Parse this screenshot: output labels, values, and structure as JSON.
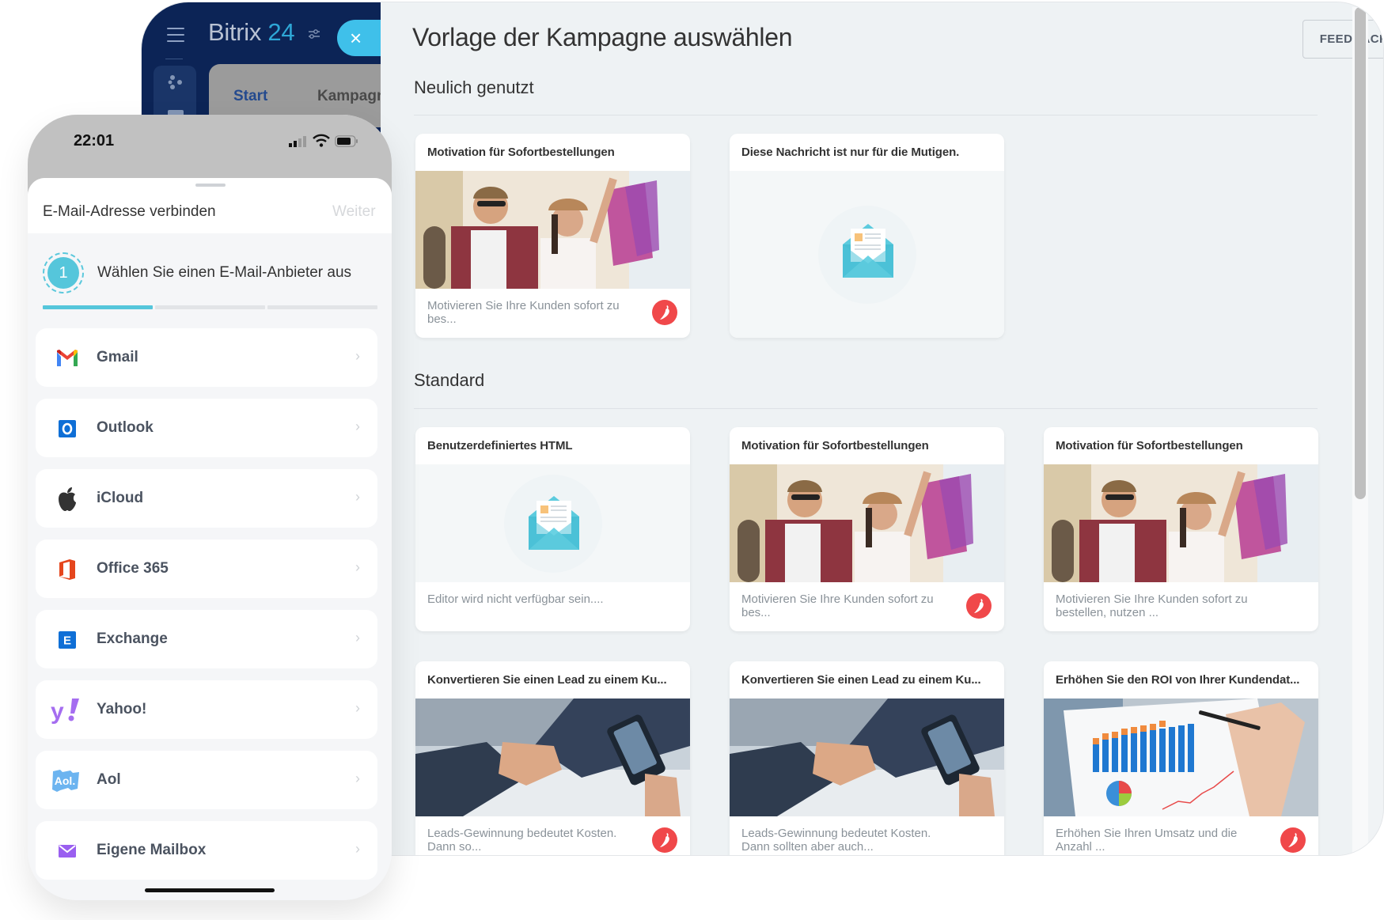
{
  "bitrix": {
    "logo_text": "Bitrix",
    "logo_number": "24",
    "close_label": "×",
    "tabs": [
      {
        "label": "Start",
        "active": true
      },
      {
        "label": "Kampagnen",
        "active": false
      }
    ]
  },
  "panel": {
    "title": "Vorlage der Kampagne auswählen",
    "feedback_button": "FEEDBACKFORMULAR",
    "sections": [
      {
        "title": "Neulich genutzt",
        "cards": [
          {
            "title": "Motivation für Sofortbestellungen",
            "media": "shopping-photo",
            "description": "Motivieren Sie Ihre Kunden sofort zu bes...",
            "badge": true
          },
          {
            "title": "Diese Nachricht ist nur für die Mutigen.",
            "media": "envelope-placeholder",
            "description": "",
            "badge": false
          }
        ]
      },
      {
        "title": "Standard",
        "cards": [
          {
            "title": "Benutzerdefiniertes HTML",
            "media": "envelope-placeholder",
            "description": "Editor wird nicht verfügbar sein....",
            "badge": false
          },
          {
            "title": "Motivation für Sofortbestellungen",
            "media": "shopping-photo",
            "description": "Motivieren Sie Ihre Kunden sofort zu bes...",
            "badge": true
          },
          {
            "title": "Motivation für Sofortbestellungen",
            "media": "shopping-photo",
            "description": "Motivieren Sie Ihre Kunden sofort zu bestellen, nutzen ...",
            "badge": false
          },
          {
            "title": "Konvertieren Sie einen Lead zu einem Ku...",
            "media": "handshake-photo",
            "description": "Leads-Gewinnung bedeutet Kosten. Dann so...",
            "badge": true
          },
          {
            "title": "Konvertieren Sie einen Lead zu einem Ku...",
            "media": "handshake-photo",
            "description": "Leads-Gewinnung bedeutet Kosten. Dann sollten aber auch...",
            "badge": false
          },
          {
            "title": "Erhöhen Sie den ROI von Ihrer Kundendat...",
            "media": "chart-photo",
            "description": "Erhöhen Sie Ihren Umsatz und die Anzahl ...",
            "badge": true
          }
        ]
      }
    ],
    "colors": {
      "badge": "#f0484a",
      "envelope": "#4fc3d8"
    }
  },
  "phone": {
    "time": "22:01",
    "sheet_title": "E-Mail-Adresse verbinden",
    "next_button": "Weiter",
    "step_number": "1",
    "step_text": "Wählen Sie einen E-Mail-Anbieter aus",
    "progress": {
      "current_step": 1,
      "total_steps": 3
    },
    "providers": [
      {
        "label": "Gmail",
        "icon": "gmail-icon"
      },
      {
        "label": "Outlook",
        "icon": "outlook-icon"
      },
      {
        "label": "iCloud",
        "icon": "apple-icon"
      },
      {
        "label": "Office 365",
        "icon": "office365-icon"
      },
      {
        "label": "Exchange",
        "icon": "exchange-icon"
      },
      {
        "label": "Yahoo!",
        "icon": "yahoo-icon"
      },
      {
        "label": "Aol",
        "icon": "aol-icon"
      },
      {
        "label": "Eigene Mailbox",
        "icon": "mailbox-icon"
      }
    ],
    "accent": "#55c6db"
  }
}
